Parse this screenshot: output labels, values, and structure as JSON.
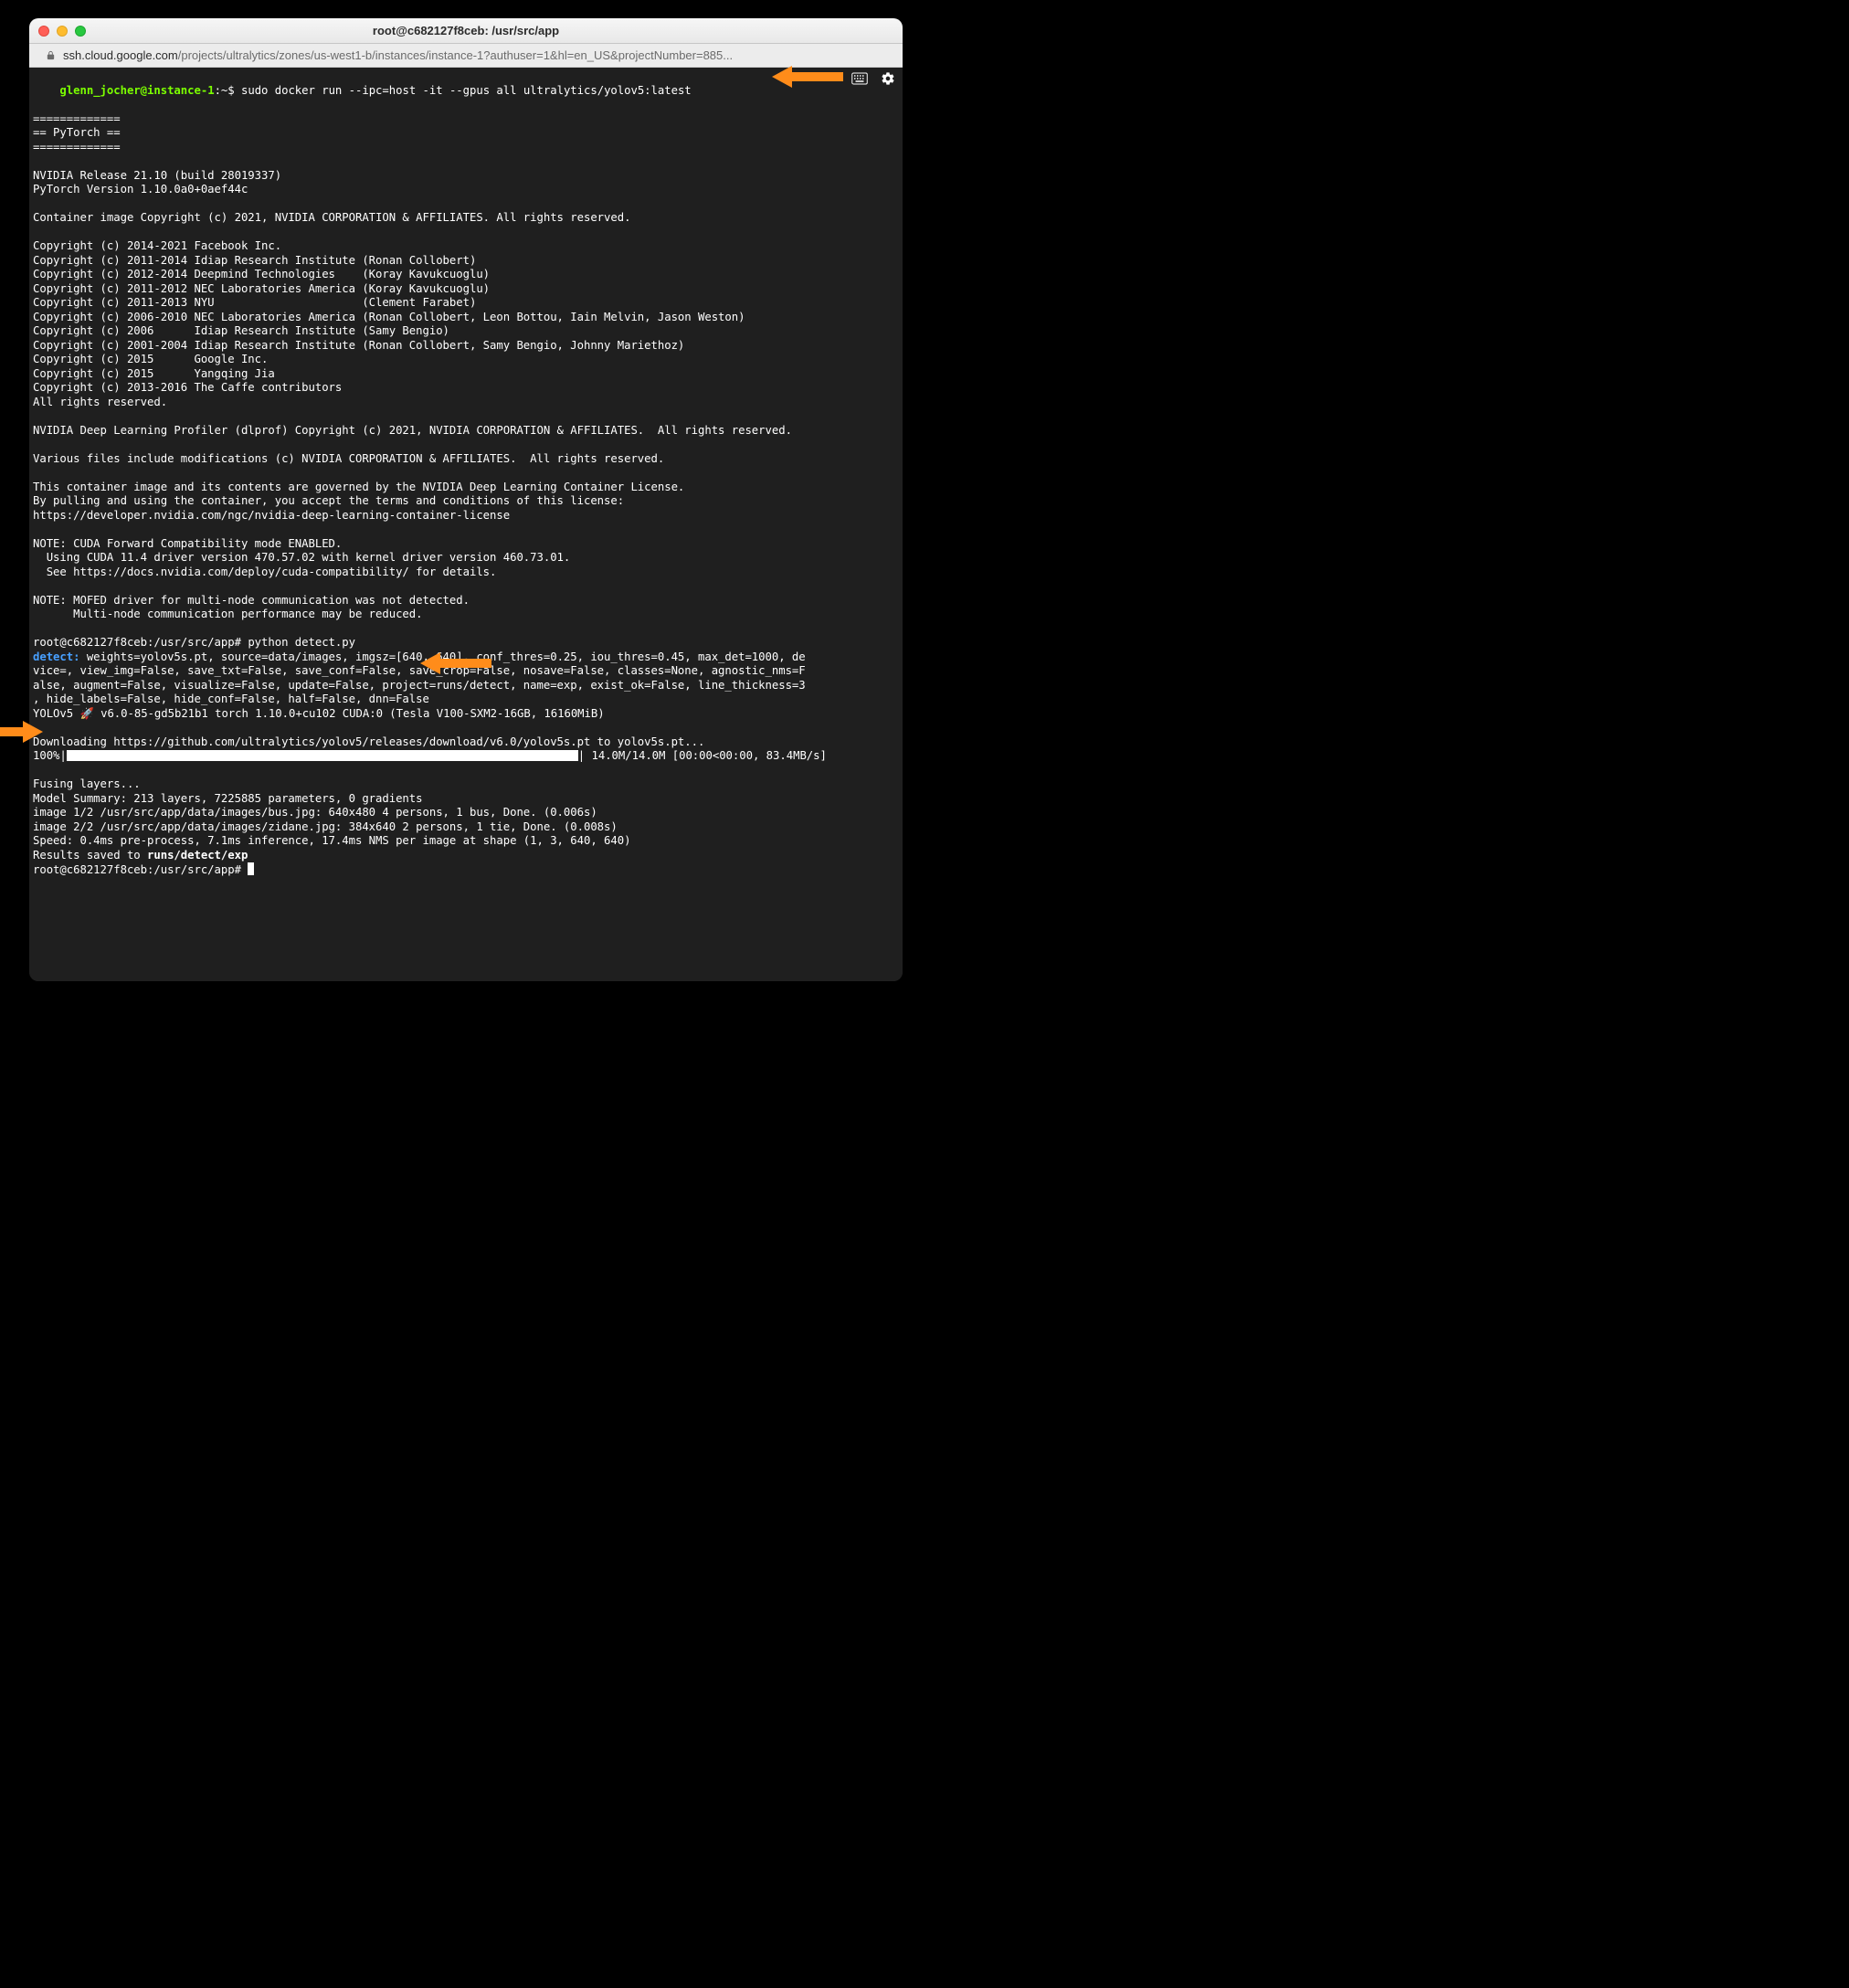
{
  "window": {
    "title": "root@c682127f8ceb: /usr/src/app",
    "url_host": "ssh.cloud.google.com",
    "url_path": "/projects/ultralytics/zones/us-west1-b/instances/instance-1?authuser=1&hl=en_US&projectNumber=885..."
  },
  "cmd1": {
    "user": "glenn_jocher@instance-1",
    "sep": ":~$ ",
    "text": "sudo docker run --ipc=host -it --gpus all ultralytics/yolov5:latest"
  },
  "banner": {
    "div": "=============",
    "py": "== PyTorch ==",
    "nvrel": "NVIDIA Release 21.10 (build 28019337)",
    "ptver": "PyTorch Version 1.10.0a0+0aef44c",
    "ccopy": "Container image Copyright (c) 2021, NVIDIA CORPORATION & AFFILIATES. All rights reserved.",
    "c1": "Copyright (c) 2014-2021 Facebook Inc.",
    "c2": "Copyright (c) 2011-2014 Idiap Research Institute (Ronan Collobert)",
    "c3": "Copyright (c) 2012-2014 Deepmind Technologies    (Koray Kavukcuoglu)",
    "c4": "Copyright (c) 2011-2012 NEC Laboratories America (Koray Kavukcuoglu)",
    "c5": "Copyright (c) 2011-2013 NYU                      (Clement Farabet)",
    "c6": "Copyright (c) 2006-2010 NEC Laboratories America (Ronan Collobert, Leon Bottou, Iain Melvin, Jason Weston)",
    "c7": "Copyright (c) 2006      Idiap Research Institute (Samy Bengio)",
    "c8": "Copyright (c) 2001-2004 Idiap Research Institute (Ronan Collobert, Samy Bengio, Johnny Mariethoz)",
    "c9": "Copyright (c) 2015      Google Inc.",
    "c10": "Copyright (c) 2015      Yangqing Jia",
    "c11": "Copyright (c) 2013-2016 The Caffe contributors",
    "arr": "All rights reserved.",
    "dlprof": "NVIDIA Deep Learning Profiler (dlprof) Copyright (c) 2021, NVIDIA CORPORATION & AFFILIATES.  All rights reserved.",
    "var": "Various files include modifications (c) NVIDIA CORPORATION & AFFILIATES.  All rights reserved.",
    "lic1": "This container image and its contents are governed by the NVIDIA Deep Learning Container License.",
    "lic2": "By pulling and using the container, you accept the terms and conditions of this license:",
    "lic3": "https://developer.nvidia.com/ngc/nvidia-deep-learning-container-license",
    "note1a": "NOTE: CUDA Forward Compatibility mode ENABLED.",
    "note1b": "  Using CUDA 11.4 driver version 470.57.02 with kernel driver version 460.73.01.",
    "note1c": "  See https://docs.nvidia.com/deploy/cuda-compatibility/ for details.",
    "note2a": "NOTE: MOFED driver for multi-node communication was not detected.",
    "note2b": "      Multi-node communication performance may be reduced."
  },
  "cmd2": {
    "prompt": "root@c682127f8ceb:/usr/src/app# ",
    "text": "python detect.py"
  },
  "detect": {
    "label": "detect: ",
    "l1": "weights=yolov5s.pt, source=data/images, imgsz=[640, 640], conf_thres=0.25, iou_thres=0.45, max_det=1000, de",
    "l2": "vice=, view_img=False, save_txt=False, save_conf=False, save_crop=False, nosave=False, classes=None, agnostic_nms=F",
    "l3": "alse, augment=False, visualize=False, update=False, project=runs/detect, name=exp, exist_ok=False, line_thickness=3",
    "l4": ", hide_labels=False, hide_conf=False, half=False, dnn=False"
  },
  "yolo": "YOLOv5 🚀 v6.0-85-gd5b21b1 torch 1.10.0+cu102 CUDA:0 (Tesla V100-SXM2-16GB, 16160MiB)",
  "download": "Downloading https://github.com/ultralytics/yolov5/releases/download/v6.0/yolov5s.pt to yolov5s.pt...",
  "progress": {
    "pct": "100%",
    "tail": " 14.0M/14.0M [00:00<00:00, 83.4MB/s]"
  },
  "inf": {
    "fusing": "Fusing layers...",
    "summary": "Model Summary: 213 layers, 7225885 parameters, 0 gradients",
    "img1": "image 1/2 /usr/src/app/data/images/bus.jpg: 640x480 4 persons, 1 bus, Done. (0.006s)",
    "img2": "image 2/2 /usr/src/app/data/images/zidane.jpg: 384x640 2 persons, 1 tie, Done. (0.008s)",
    "speed": "Speed: 0.4ms pre-process, 7.1ms inference, 17.4ms NMS per image at shape (1, 3, 640, 640)",
    "res_pre": "Results saved to ",
    "res_bold": "runs/detect/exp"
  },
  "cmd3": {
    "prompt": "root@c682127f8ceb:/usr/src/app# "
  },
  "arrow_color": "#ff8c1a"
}
